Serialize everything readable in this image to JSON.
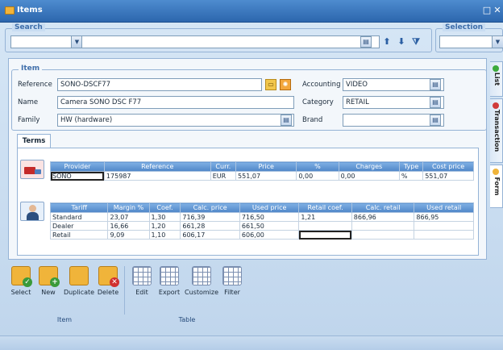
{
  "window": {
    "title": "Items",
    "accent": "#2c66ad"
  },
  "search": {
    "legend": "Search",
    "field_value": "",
    "text_value": ""
  },
  "selection": {
    "legend": "Selection",
    "value": ""
  },
  "item": {
    "legend": "Item",
    "reference_label": "Reference",
    "reference_value": "SONO-DSCF77",
    "name_label": "Name",
    "name_value": "Camera SONO DSC F77",
    "family_label": "Family",
    "family_value": "HW (hardware)",
    "accounting_label": "Accounting",
    "accounting_value": "VIDEO",
    "category_label": "Category",
    "category_value": "RETAIL",
    "brand_label": "Brand",
    "brand_value": ""
  },
  "tabs": {
    "terms": "Terms"
  },
  "providers": {
    "headers": [
      "Provider",
      "Reference",
      "Curr.",
      "Price",
      "%",
      "Charges",
      "Type",
      "Cost price"
    ],
    "rows": [
      [
        "SONO",
        "175987",
        "EUR",
        "551,07",
        "0,00",
        "0,00",
        "%",
        "551,07"
      ]
    ]
  },
  "tariffs": {
    "headers": [
      "Tariff",
      "Margin %",
      "Coef.",
      "Calc. price",
      "Used price",
      "Retail coef.",
      "Calc. retail",
      "Used retail"
    ],
    "rows": [
      [
        "Standard",
        "23,07",
        "1,30",
        "716,39",
        "716,50",
        "1,21",
        "866,96",
        "866,95"
      ],
      [
        "Dealer",
        "16,66",
        "1,20",
        "661,28",
        "661,50",
        "",
        "",
        ""
      ],
      [
        "Retail",
        "9,09",
        "1,10",
        "606,17",
        "606,00",
        "",
        "",
        ""
      ]
    ]
  },
  "side_tabs": [
    "List",
    "Transaction",
    "Form"
  ],
  "ribbon": {
    "item_buttons": [
      "Select",
      "New",
      "Duplicate",
      "Delete"
    ],
    "table_buttons": [
      "Edit",
      "Export",
      "Customize",
      "Filter"
    ],
    "item_group": "Item",
    "table_group": "Table"
  }
}
